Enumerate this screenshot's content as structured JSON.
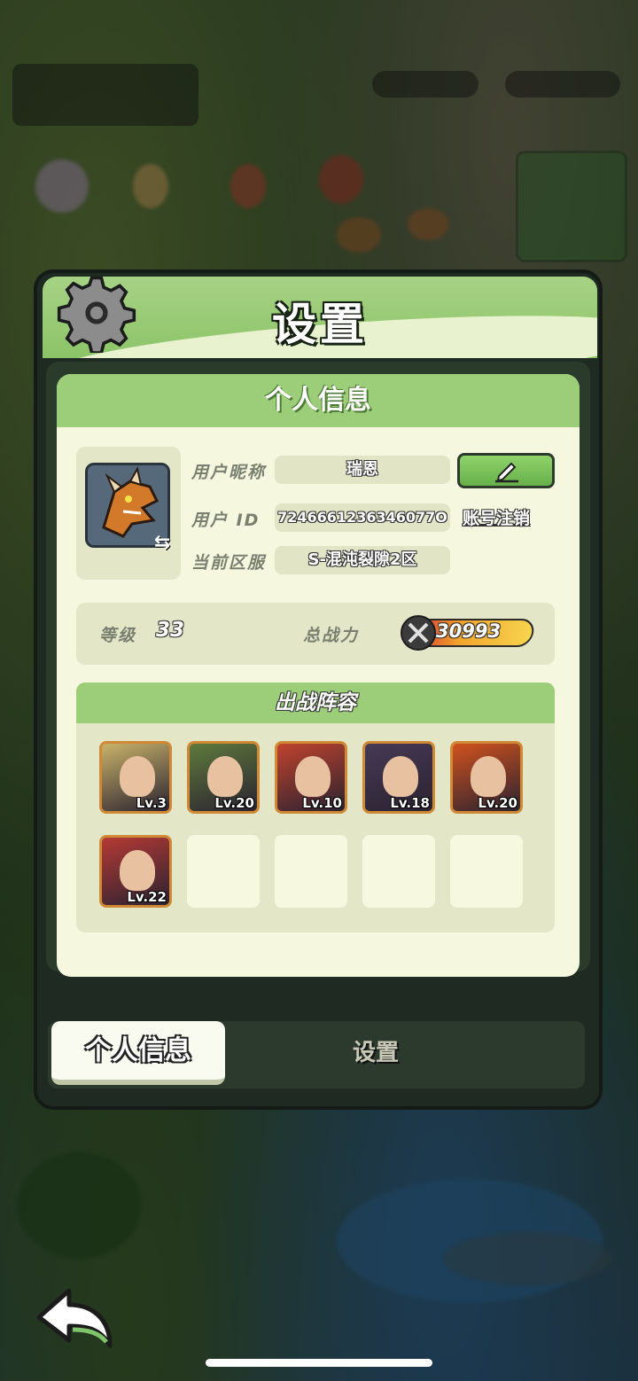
{
  "colors": {
    "header_green": "#9ccd78",
    "card_bg": "#f6f7df",
    "edit_button": "#66b04a",
    "slot_border": "#d08a36"
  },
  "panel": {
    "title": "设置",
    "title_icon": "gear-icon"
  },
  "profile": {
    "section_title": "个人信息",
    "nickname_label": "用户昵称",
    "nickname_value": "瑞恩",
    "id_label": "用户 ID",
    "id_value": "7246661236346077O",
    "server_label": "当前区服",
    "server_value": "S-混沌裂隙2区",
    "edit_icon": "pencil-icon",
    "cancel_account_label": "账号注销"
  },
  "stats": {
    "level_label": "等级",
    "level_value": "33",
    "power_label": "总战力",
    "power_value": "30993"
  },
  "lineup": {
    "title": "出战阵容",
    "heroes": [
      {
        "level": "Lv.3",
        "color": "#c9b36a"
      },
      {
        "level": "Lv.20",
        "color": "#5f7a3c"
      },
      {
        "level": "Lv.10",
        "color": "#c0432e"
      },
      {
        "level": "Lv.18",
        "color": "#463a56"
      },
      {
        "level": "Lv.20",
        "color": "#d0521e"
      },
      {
        "level": "Lv.22",
        "color": "#b53a35"
      }
    ],
    "empty_slots": 4
  },
  "tabs": {
    "active": "个人信息",
    "inactive": "设置"
  },
  "nav": {
    "back_icon": "back-arrow-icon"
  }
}
